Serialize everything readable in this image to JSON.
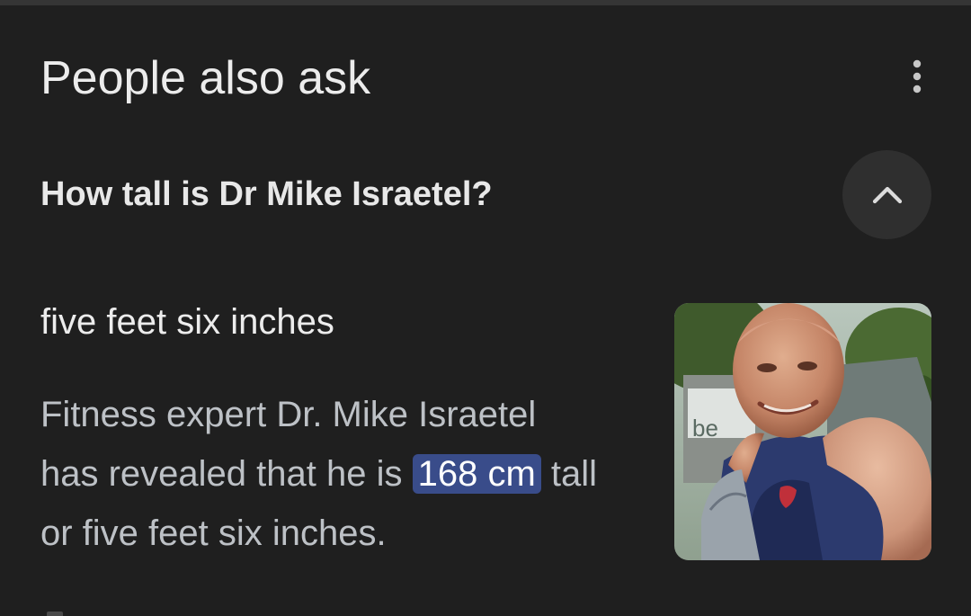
{
  "section": {
    "title": "People also ask",
    "more_icon": "more-vert-icon"
  },
  "question": {
    "text": "How tall is Dr Mike Israetel?",
    "toggle_icon": "chevron-up-icon",
    "expanded": true
  },
  "answer": {
    "headline": "five feet six inches",
    "snippet_line1": "Fitness expert Dr. Mike Israetel",
    "snippet_line2_before": "has revealed that he is ",
    "snippet_highlight": "168 cm",
    "snippet_line2_after": " tall",
    "snippet_line3": "or five feet six inches.",
    "highlight_color": "#394c8a",
    "thumbnail_sign_text": "be"
  }
}
